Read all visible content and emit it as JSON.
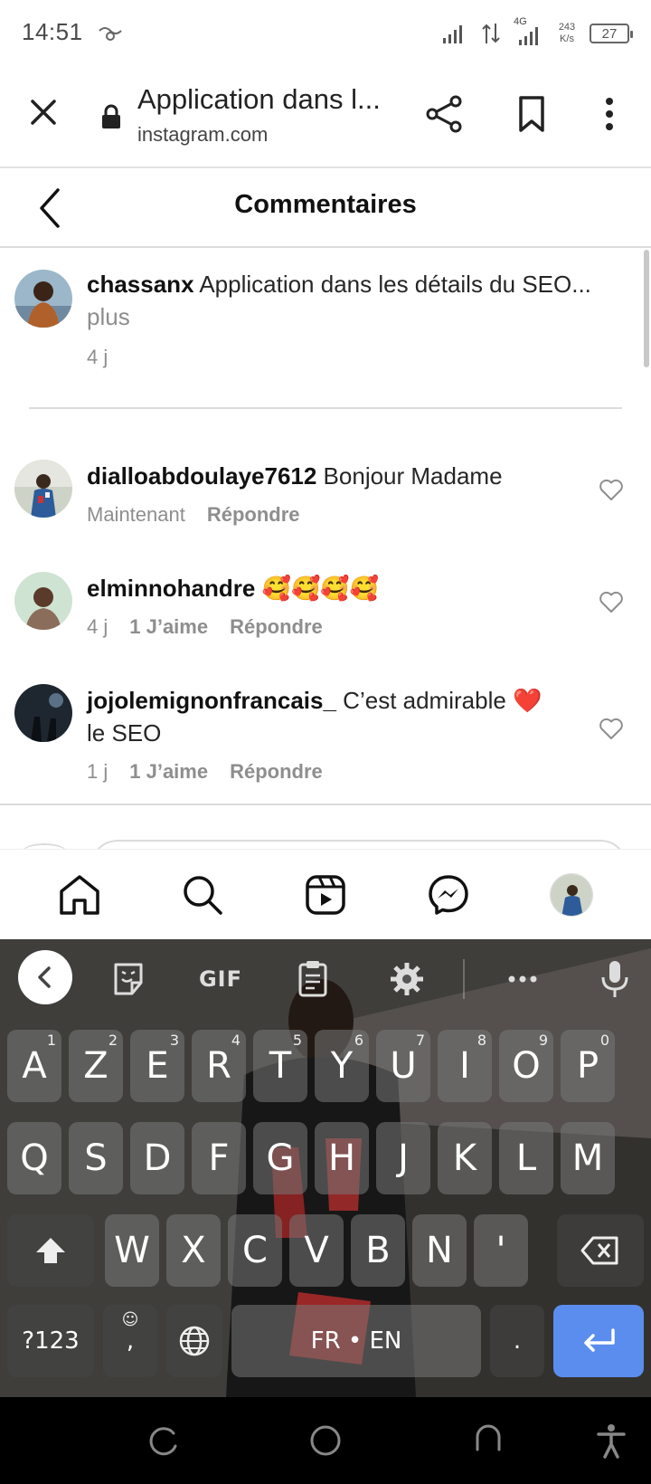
{
  "status_bar": {
    "time": "14:51",
    "network": "4G",
    "speed_value": "243",
    "speed_unit": "K/s",
    "battery": "27"
  },
  "browser": {
    "title": "Application dans l...",
    "url": "instagram.com"
  },
  "comments_header": {
    "title": "Commentaires"
  },
  "caption": {
    "username": "chassanx",
    "text": " Application dans les détails du SEO...",
    "more": "plus",
    "time": "4 j"
  },
  "comments": [
    {
      "username": "dialloabdoulaye7612",
      "text": " Bonjour Madame",
      "text2": "",
      "time": "Maintenant",
      "likes": "",
      "reply": "Répondre"
    },
    {
      "username": "elminnohandre",
      "text": " 🥰🥰🥰🥰",
      "text2": "",
      "time": "4 j",
      "likes": "1 J’aime",
      "reply": "Répondre"
    },
    {
      "username": "jojolemignonfrancais_",
      "text": " C’est admirable ❤️",
      "text2": "le SEO",
      "time": "1 j",
      "likes": "1 J’aime",
      "reply": "Répondre"
    }
  ],
  "keyboard": {
    "toolbar": {
      "gif": "GIF"
    },
    "row1": [
      {
        "k": "A",
        "h": "1"
      },
      {
        "k": "Z",
        "h": "2"
      },
      {
        "k": "E",
        "h": "3"
      },
      {
        "k": "R",
        "h": "4"
      },
      {
        "k": "T",
        "h": "5"
      },
      {
        "k": "Y",
        "h": "6"
      },
      {
        "k": "U",
        "h": "7"
      },
      {
        "k": "I",
        "h": "8"
      },
      {
        "k": "O",
        "h": "9"
      },
      {
        "k": "P",
        "h": "0"
      }
    ],
    "row2": [
      "Q",
      "S",
      "D",
      "F",
      "G",
      "H",
      "J",
      "K",
      "L",
      "M"
    ],
    "row3": [
      "W",
      "X",
      "C",
      "V",
      "B",
      "N",
      "'"
    ],
    "symbols": "?123",
    "comma": ",",
    "space": "FR • EN",
    "period": "."
  },
  "colors": {
    "accent": "#5b8def",
    "muted": "#8e8e8e",
    "heart_red": "#e0245e"
  }
}
